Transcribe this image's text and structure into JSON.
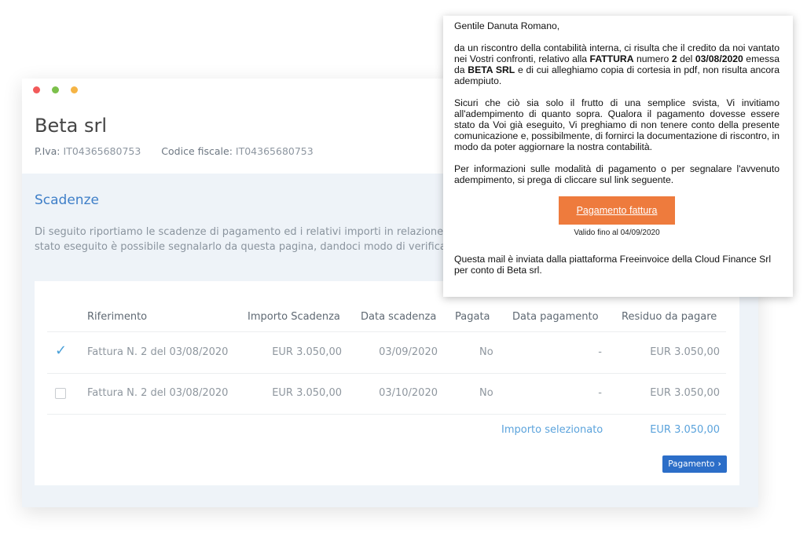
{
  "window": {
    "company_name": "Beta srl",
    "piva_label": "P.Iva:",
    "piva_value": "IT04365680753",
    "cf_label": "Codice fiscale:",
    "cf_value": "IT04365680753",
    "section_title": "Scadenze",
    "description_line1": "Di seguito riportiamo le scadenze di pagamento ed i relativi importi in relazione a",
    "description_line2": "stato eseguito è possibile segnalarlo da questa pagina, dandoci modo di verifica"
  },
  "table": {
    "headers": [
      "Riferimento",
      "Importo Scadenza",
      "Data scadenza",
      "Pagata",
      "Data pagamento",
      "Residuo da pagare"
    ],
    "rows": [
      {
        "selected": true,
        "riferimento": "Fattura N. 2 del 03/08/2020",
        "importo": "EUR 3.050,00",
        "data_scadenza": "03/09/2020",
        "pagata": "No",
        "data_pagamento": "-",
        "residuo": "EUR 3.050,00"
      },
      {
        "selected": false,
        "riferimento": "Fattura N. 2 del 03/08/2020",
        "importo": "EUR 3.050,00",
        "data_scadenza": "03/10/2020",
        "pagata": "No",
        "data_pagamento": "-",
        "residuo": "EUR 3.050,00"
      }
    ],
    "selected_label": "Importo selezionato",
    "selected_value": "EUR 3.050,00",
    "pay_button_label": "Pagamento",
    "pay_button_icon": "chevron-right-icon"
  },
  "email": {
    "greeting": "Gentile Danuta Romano,",
    "p1_a": "da un riscontro della contabilità interna, ci risulta che il credito da noi vantato nei Vostri confronti, relativo alla ",
    "p1_invoice_word": "FATTURA",
    "p1_b": " numero ",
    "p1_number": "2",
    "p1_c": " del ",
    "p1_date": "03/08/2020",
    "p1_d": " emessa da ",
    "p1_issuer": "BETA SRL",
    "p1_e": " e di cui alleghiamo copia di cortesia in pdf, non risulta ancora adempiuto.",
    "p2": "Sicuri che ciò sia solo il frutto di una semplice svista, Vi invitiamo all'adempimento di quanto sopra. Qualora il pagamento dovesse essere stato da Voi già eseguito, Vi preghiamo di non tenere conto della presente comunicazione e, possibilmente, di fornirci la documentazione di riscontro, in modo da poter aggiornare la nostra contabilità.",
    "p3": "Per informazioni sulle modalità di pagamento o per segnalare l'avvenuto adempimento, si prega di cliccare sul link seguente.",
    "button_label": "Pagamento fattura",
    "valid_until": "Valido fino al 04/09/2020",
    "footer": "Questa mail è inviata dalla piattaforma Freeinvoice della Cloud Finance Srl per conto di Beta srl."
  },
  "colors": {
    "accent_blue": "#3f7fc8",
    "button_blue": "#2c6ec8",
    "email_button_orange": "#ee7b3d",
    "dot_red": "#f25a5a",
    "dot_green": "#7cc04b",
    "dot_yellow": "#f5b445"
  }
}
